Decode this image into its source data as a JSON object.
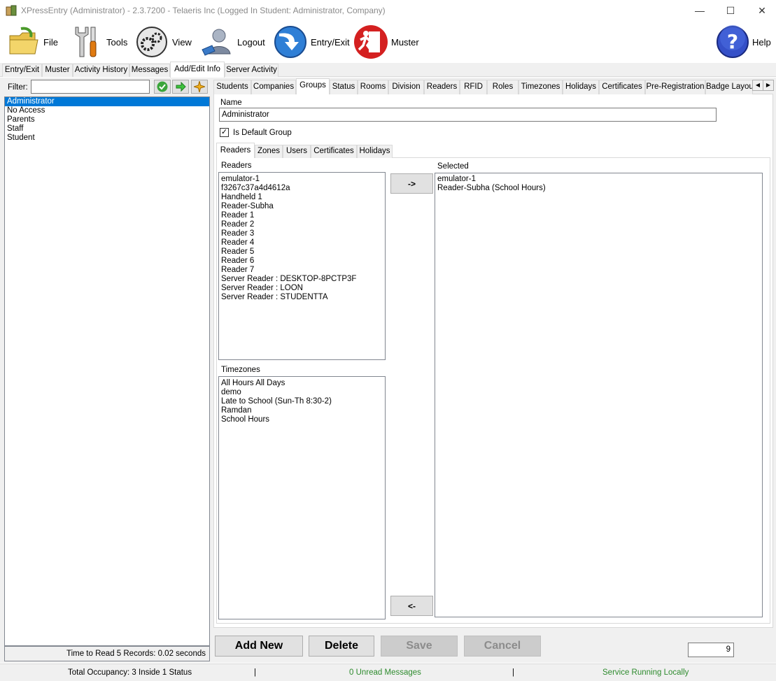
{
  "window": {
    "title": "XPressEntry (Administrator)  - 2.3.7200 - Telaeris Inc (Logged In Student: Administrator, Company)",
    "controls": {
      "minimize": "—",
      "maximize": "☐",
      "close": "✕"
    }
  },
  "toolbar": {
    "file": "File",
    "tools": "Tools",
    "view": "View",
    "logout": "Logout",
    "entry_exit": "Entry/Exit",
    "muster": "Muster",
    "help": "Help"
  },
  "top_tabs": [
    "Entry/Exit",
    "Muster",
    "Activity History",
    "Messages",
    "Add/Edit Info",
    "Server Activity"
  ],
  "filter": {
    "label": "Filter:",
    "value": ""
  },
  "groups": [
    "Administrator",
    "No Access",
    "Parents",
    "Staff",
    "Student"
  ],
  "left_status": "Time to Read 5 Records: 0.02 seconds",
  "sub_tabs": [
    "Students",
    "Companies",
    "Groups",
    "Status",
    "Rooms",
    "Division",
    "Readers",
    "RFID",
    "Roles",
    "Timezones",
    "Holidays",
    "Certificates",
    "Pre-Registration",
    "Badge Layou"
  ],
  "form": {
    "name_label": "Name",
    "name_value": "Administrator",
    "default_label": "Is Default Group",
    "default_checked": "✓"
  },
  "inner_tabs": [
    "Readers",
    "Zones",
    "Users",
    "Certificates",
    "Holidays"
  ],
  "readers": {
    "label": "Readers",
    "items": [
      "emulator-1",
      "f3267c37a4d4612a",
      "Handheld 1",
      "Reader-Subha",
      "Reader 1",
      "Reader 2",
      "Reader 3",
      "Reader 4",
      "Reader 5",
      "Reader 6",
      "Reader 7",
      "Server Reader : DESKTOP-8PCTP3F",
      "Server Reader : LOON",
      "Server Reader : STUDENTTA"
    ]
  },
  "timezones": {
    "label": "Timezones",
    "items": [
      "All Hours All Days",
      "demo",
      "Late to School (Sun-Th 8:30-2)",
      "Ramdan",
      "School Hours"
    ]
  },
  "selected": {
    "label": "Selected",
    "items": [
      "emulator-1",
      "Reader-Subha (School Hours)"
    ]
  },
  "move": {
    "add": "->",
    "remove": "<-"
  },
  "actions": {
    "add_new": "Add New",
    "delete": "Delete",
    "save": "Save",
    "cancel": "Cancel"
  },
  "record_count": "9",
  "status_bar": {
    "occupancy": "Total Occupancy: 3 Inside 1 Status",
    "sep1": "|",
    "messages": "0 Unread Messages",
    "sep2": "|",
    "service": "Service Running Locally"
  },
  "colors": {
    "selection": "#0078d7",
    "status_green": "#2e8b2e",
    "help_blue": "#2a3fb0",
    "muster_red": "#d42020"
  }
}
